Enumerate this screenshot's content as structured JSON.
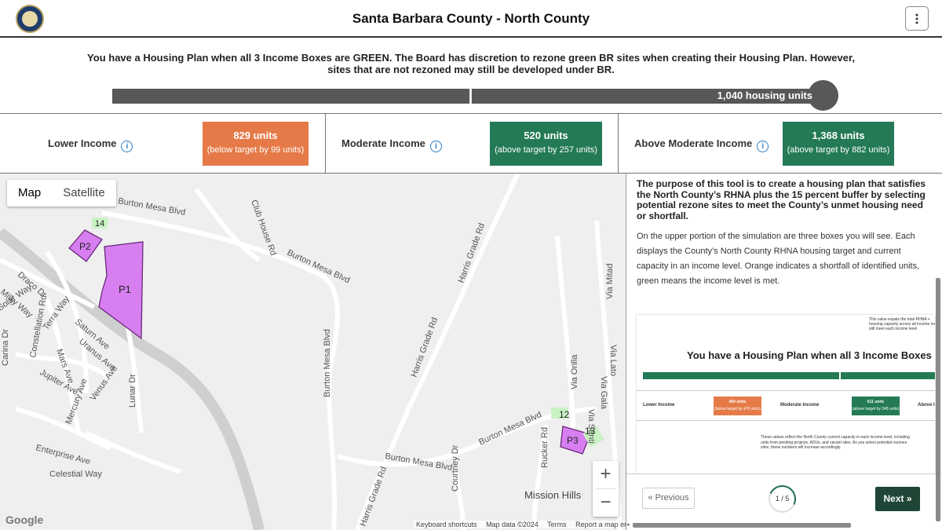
{
  "header": {
    "title": "Santa Barbara County - North County",
    "menu_icon": "kebab-menu-icon"
  },
  "notice": {
    "line1": "You have a Housing Plan when all 3 Income Boxes are GREEN. The Board has discretion to rezone green BR sites when creating their Housing Plan. However,",
    "line2": "sites that are not rezoned may still be developed under BR."
  },
  "progress": {
    "label": "1,040 housing units"
  },
  "income_boxes": [
    {
      "label": "Lower Income",
      "units": "829 units",
      "target": "(below target by 99 units)",
      "color": "#e57a48"
    },
    {
      "label": "Moderate Income",
      "units": "520 units",
      "target": "(above target by 257 units)",
      "color": "#237a55"
    },
    {
      "label": "Above Moderate Income",
      "units": "1,368 units",
      "target": "(above target by 882 units)",
      "color": "#237a55"
    }
  ],
  "map": {
    "toggle": {
      "map": "Map",
      "satellite": "Satellite"
    },
    "zoom_in": "+",
    "zoom_out": "−",
    "parcels": [
      "P1",
      "P2",
      "P3"
    ],
    "badges": [
      "14",
      "12",
      "13"
    ],
    "labels": [
      "Burton Mesa Blvd",
      "Burton Mesa Blvd",
      "Burton Mesa Blvd",
      "Burton Mesa Blvd",
      "Burton Mesa Blvd",
      "Club House Rd",
      "Harris Grade Rd",
      "Harris Grade Rd",
      "Harris Grade Rd",
      "Constellation Rd",
      "Saturn Ave",
      "Uranus Ave",
      "Jupiter Ave",
      "Mars Ave",
      "Venus Ave",
      "Mercury Ave",
      "Lunar Dr",
      "Enterprise Ave",
      "Celestial Way",
      "Terra Way",
      "Draco Dr",
      "Milky Way",
      "Solar Way",
      "Carina Dr",
      "Rucker Rd",
      "Courtney Dr",
      "Via Orilla",
      "Via Senti",
      "Via Gala",
      "Via Lato",
      "Via Mitad",
      "Mission Hills"
    ],
    "attribution": [
      "Keyboard shortcuts",
      "Map data ©2024",
      "Terms",
      "Report a map error"
    ],
    "google": "Google",
    "colors": {
      "parcel": "#d77ef0",
      "parcel_edge": "#6a2a7a",
      "badge": "#c9f2c4",
      "road": "#d0d0d0"
    }
  },
  "panel": {
    "intro_bold": "The purpose of this tool is to create a housing plan that satisfies the North County’s RHNA plus the 15 percent buffer by selecting potential rezone sites to meet the County’s unmet housing need or shortfall.",
    "intro_body": "On the upper portion of the simulation are three boxes you will see. Each displays the County’s North County RHNA housing target and current capacity in an income level. Orange indicates a shortfall of identified units, green means the income level is met.",
    "preview": {
      "top_note": "This value equals the total RHNA + housing capacity across all income must still meet each income level",
      "title": "You have a Housing Plan when all 3 Income Boxes",
      "lower_label": "Lower Income",
      "lower_units": "450 units",
      "lower_target": "(below target by 479 units)",
      "moderate_label": "Moderate Income",
      "moderate_units": "611 units",
      "moderate_target": "(above target by 348 units)",
      "above_label": "Above I",
      "note": "These values reflect the North County current capacity in each income level, including units from pending projects, ADUs, and vacant sites. As you select potential rezones sites, these numbers will increase accordingly."
    },
    "prev_label": "« Previous",
    "page": "1 / 5",
    "next_label": "Next »"
  }
}
